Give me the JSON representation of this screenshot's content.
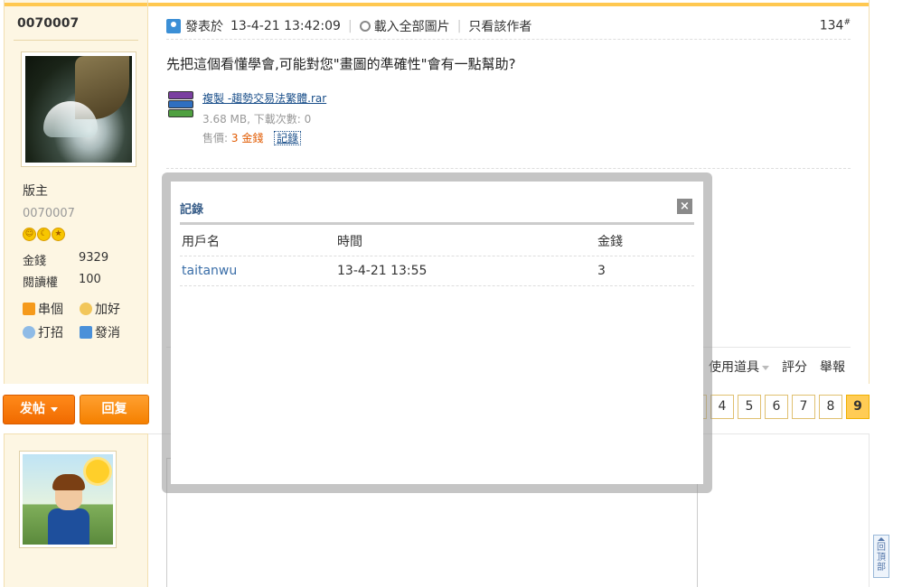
{
  "post": {
    "author": "0070007",
    "group": "版主",
    "custom_title": "0070007",
    "medals": [
      "☺",
      "☾",
      "★"
    ],
    "stats": [
      {
        "label": "金錢",
        "value": "9329"
      },
      {
        "label": "閱讀權",
        "value": "100"
      }
    ],
    "side_links": [
      {
        "icon": "home-icon",
        "label": "串個"
      },
      {
        "icon": "handshake-icon",
        "label": "加好"
      },
      {
        "icon": "chat-icon",
        "label": "打招"
      },
      {
        "icon": "mail-icon",
        "label": "發消"
      }
    ],
    "posted_label": "發表於",
    "posted_time": "13-4-21 13:42:09",
    "load_images": "載入全部圖片",
    "only_author": "只看該作者",
    "floor": "134",
    "floor_sup": "#",
    "body": "先把這個看懂學會,可能對您\"畫圖的準確性\"會有一點幫助?",
    "attachment": {
      "name": "複製 -趨勢交易法繁體.rar",
      "size": "3.68 MB, 下載次數: 0",
      "price_label": "售價:",
      "price_value": "3 金錢",
      "record_label": "記錄"
    },
    "foot_actions": {
      "tools": "使用道具",
      "rate": "評分",
      "report": "舉報"
    }
  },
  "actions": {
    "post_label": "发帖",
    "reply_label": "回复"
  },
  "pager": [
    "4",
    "5",
    "6",
    "7",
    "8",
    "9"
  ],
  "pager_current": "9",
  "back_to_top": "回頂部",
  "modal": {
    "title": "記錄",
    "close": "×",
    "headers": [
      "用戶名",
      "時間",
      "金錢"
    ],
    "rows": [
      {
        "user": "taitanwu",
        "time": "13-4-21 13:55",
        "amount": "3"
      }
    ]
  }
}
